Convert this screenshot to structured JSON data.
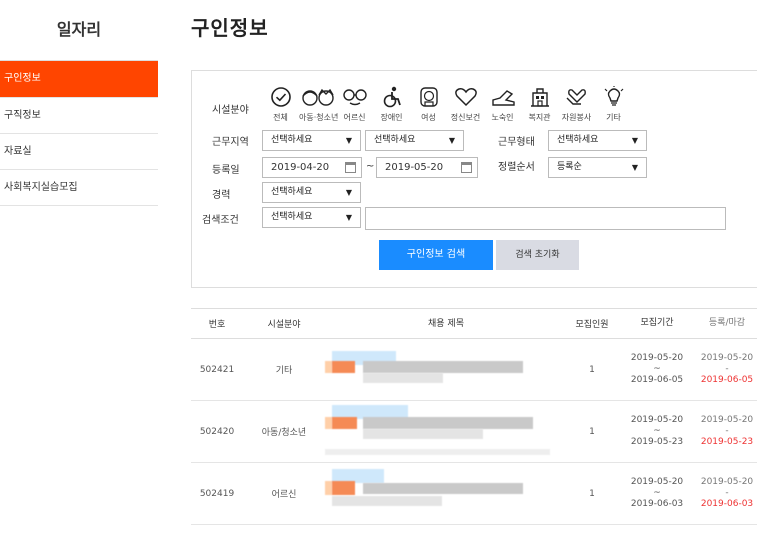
{
  "sidebar": {
    "title": "일자리",
    "items": [
      {
        "label": "구인정보",
        "active": true
      },
      {
        "label": "구직정보"
      },
      {
        "label": "자료실"
      },
      {
        "label": "사회복지실습모집"
      }
    ]
  },
  "page": {
    "title": "구인정보"
  },
  "search": {
    "facility_label": "시설분야",
    "categories": [
      {
        "label": "전체",
        "icon": "check-circle-icon"
      },
      {
        "label": "아동·청소년",
        "icon": "children-icon"
      },
      {
        "label": "어르신",
        "icon": "glasses-icon"
      },
      {
        "label": "장애인",
        "icon": "wheelchair-icon"
      },
      {
        "label": "여성",
        "icon": "woman-icon"
      },
      {
        "label": "정신보건",
        "icon": "heart-icon"
      },
      {
        "label": "노숙인",
        "icon": "shoe-icon"
      },
      {
        "label": "복지관",
        "icon": "building-icon"
      },
      {
        "label": "자원봉사",
        "icon": "hands-icon"
      },
      {
        "label": "기타",
        "icon": "lightbulb-icon"
      }
    ],
    "region_label": "근무지역",
    "region1": "선택하세요",
    "region2": "선택하세요",
    "worktype_label": "근무형태",
    "worktype": "선택하세요",
    "date_label": "등록일",
    "date_from": "2019-04-20",
    "date_sep": "~",
    "date_to": "2019-05-20",
    "sort_label": "정렬순서",
    "sort": "등록순",
    "career_label": "경력",
    "career": "선택하세요",
    "cond_label": "검색조건",
    "cond": "선택하세요",
    "keyword": "",
    "search_button": "구인정보 검색",
    "reset_button": "검색 초기화",
    "arrow": "▼"
  },
  "table": {
    "headers": {
      "no": "번호",
      "cat": "시설분야",
      "title": "채용 제목",
      "count": "모집인원",
      "period": "모집기간",
      "deadline": "등록/마감"
    },
    "rows": [
      {
        "no": "502421",
        "cat": "기타",
        "count": "1",
        "start": "2019-05-20",
        "sep": "~",
        "end": "2019-06-05",
        "reg": "2019-05-20",
        "dash": "-",
        "deadline": "2019-06-05"
      },
      {
        "no": "502420",
        "cat": "아동/청소년",
        "count": "1",
        "start": "2019-05-20",
        "sep": "~",
        "end": "2019-05-23",
        "reg": "2019-05-20",
        "dash": "-",
        "deadline": "2019-05-23"
      },
      {
        "no": "502419",
        "cat": "어르신",
        "count": "1",
        "start": "2019-05-20",
        "sep": "~",
        "end": "2019-06-03",
        "reg": "2019-05-20",
        "dash": "-",
        "deadline": "2019-06-03"
      }
    ]
  },
  "colors": {
    "accent": "#ff4500",
    "button": "#1a8cff",
    "deadline": "#ee3333"
  }
}
